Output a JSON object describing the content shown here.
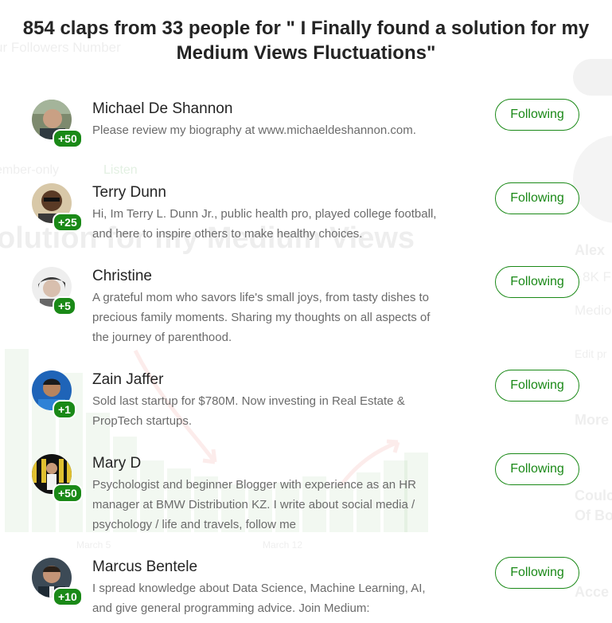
{
  "modal": {
    "title": "854 claps from 33 people for \" I Finally found a solution for my Medium Views Fluctuations\""
  },
  "people": [
    {
      "name": "Michael De Shannon",
      "claps": "+50",
      "bio": "Please review my biography at www.michaeldeshannon.com.",
      "button": "Following",
      "avatar": "avatar-michael-photo"
    },
    {
      "name": "Terry Dunn",
      "claps": "+25",
      "bio": "Hi, Im Terry L. Dunn Jr., public health pro, played college football, and here to inspire others to make healthy choices.",
      "button": "Following",
      "avatar": "avatar-terry-photo"
    },
    {
      "name": "Christine",
      "claps": "+5",
      "bio": "A grateful mom who savors life's small joys, from tasty dishes to precious family moments. Sharing my thoughts on all aspects of the journey of parenthood.",
      "button": "Following",
      "avatar": "avatar-christine-photo"
    },
    {
      "name": "Zain Jaffer",
      "claps": "+1",
      "bio": "Sold last startup for $780M. Now investing in Real Estate & PropTech startups.",
      "button": "Following",
      "avatar": "avatar-zain-photo"
    },
    {
      "name": "Mary D",
      "claps": "+50",
      "bio": "Psychologist and beginner Blogger with experience as an HR manager at BMW Distribution KZ. I write about social media / psychology / life and travels, follow me",
      "button": "Following",
      "avatar": "avatar-mary-photo"
    },
    {
      "name": "Marcus Bentele",
      "claps": "+10",
      "bio": "I spread knowledge about Data Science, Machine Learning, AI, and give general programming advice. Join Medium:",
      "button": "Following",
      "avatar": "avatar-marcus-photo"
    }
  ],
  "background": {
    "followers_heading": "ur Followers Number",
    "member_only": "ember-only",
    "listen": "Listen",
    "headline": "olution for my Medium Views",
    "author": "Alex",
    "followers_short": "8K F",
    "medium_text": "Medio",
    "edit_text": "Edit pr",
    "more_text": "More",
    "card_title_1": "Coulc",
    "card_title_2": "Of Bo",
    "card_title_3": "Acce",
    "axis_label_1": "March 5",
    "axis_label_2": "March 12"
  },
  "colors": {
    "accent": "#1a8917",
    "text": "#242424",
    "muted": "#6b6b6b"
  }
}
